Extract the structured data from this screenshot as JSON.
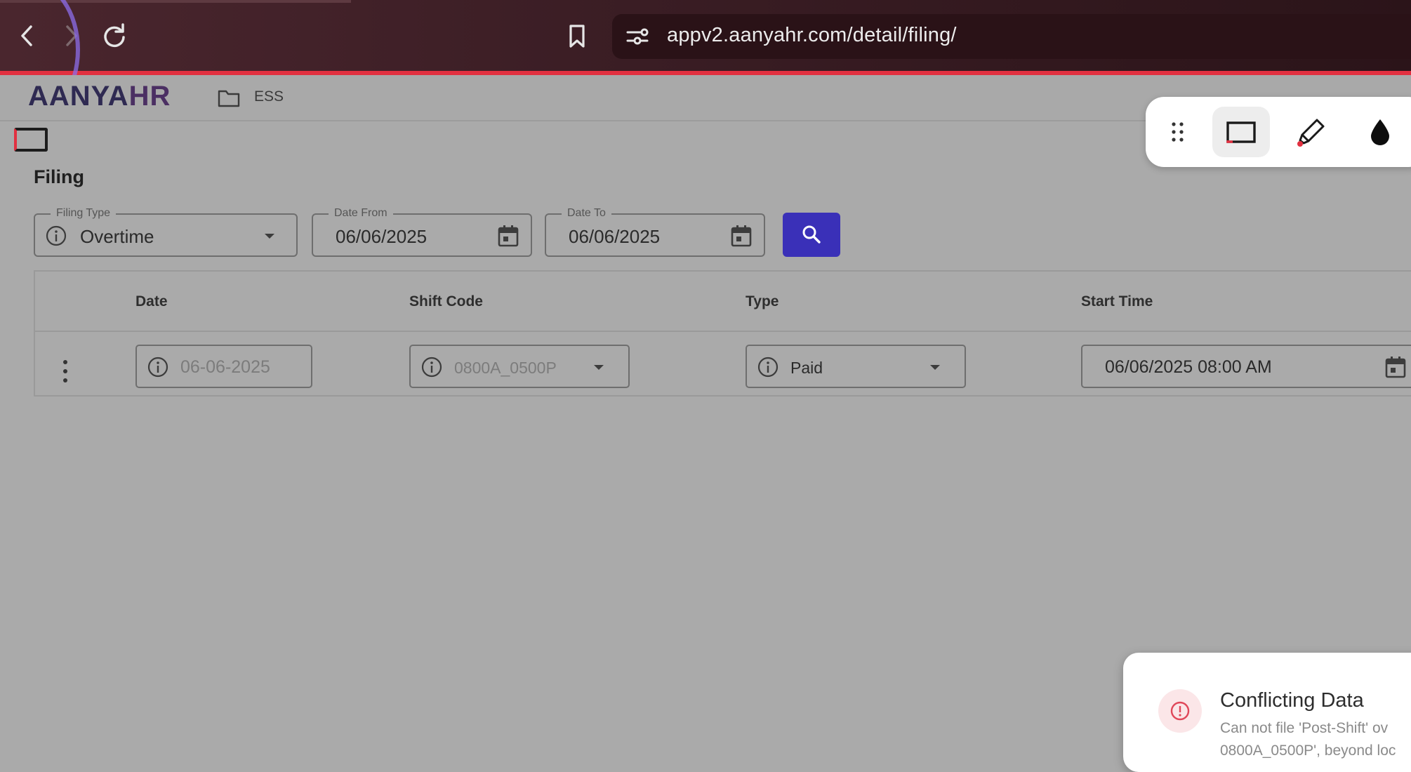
{
  "browser": {
    "url": "appv2.aanyahr.com/detail/filing/"
  },
  "app": {
    "logo_main": "AANYA",
    "logo_accent": "HR",
    "breadcrumb": "ESS"
  },
  "page": {
    "title": "Filing"
  },
  "filters": {
    "filing_type": {
      "label": "Filing Type",
      "value": "Overtime"
    },
    "date_from": {
      "label": "Date From",
      "value": "06/06/2025"
    },
    "date_to": {
      "label": "Date To",
      "value": "06/06/2025"
    }
  },
  "table": {
    "headers": {
      "date": "Date",
      "shift_code": "Shift Code",
      "type": "Type",
      "start_time": "Start Time"
    },
    "rows": [
      {
        "date": "06-06-2025",
        "shift_code": "0800A_0500P",
        "type": "Paid",
        "start_time": "06/06/2025 08:00 AM"
      }
    ]
  },
  "toast": {
    "title": "Conflicting Data",
    "line1": "Can not file 'Post-Shift' ov",
    "line2": "0800A_0500P', beyond loc"
  },
  "colors": {
    "accent": "#3a30b8",
    "chrome_border": "#e23040",
    "toast_icon": "#e0485a"
  }
}
